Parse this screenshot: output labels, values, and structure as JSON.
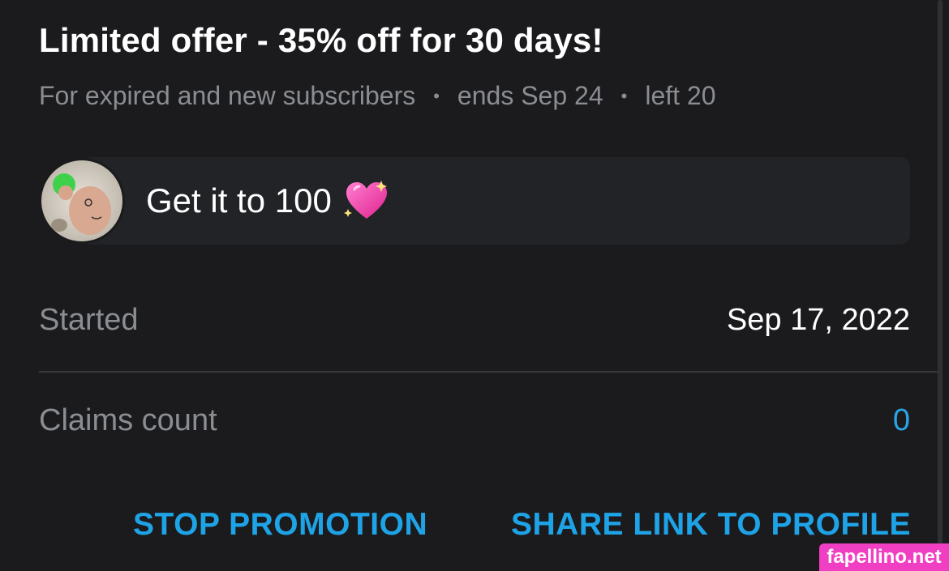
{
  "promo": {
    "title": "Limited offer - 35% off for 30 days!",
    "audience": "For expired and new subscribers",
    "ends": "ends Sep 24",
    "left": "left 20",
    "separator": "•"
  },
  "message": {
    "text": "Get it to 100",
    "emoji_icon": "sparkling-heart-icon"
  },
  "details": {
    "started_label": "Started",
    "started_value": "Sep 17, 2022",
    "claims_label": "Claims count",
    "claims_value": "0"
  },
  "actions": {
    "stop_label": "STOP PROMOTION",
    "share_label": "SHARE LINK TO PROFILE"
  },
  "watermark": {
    "text": "fapellino.net"
  },
  "colors": {
    "background": "#1b1b1d",
    "accent": "#1ea3e6",
    "muted_text": "#8a8d92",
    "watermark": "#f03fc3"
  }
}
